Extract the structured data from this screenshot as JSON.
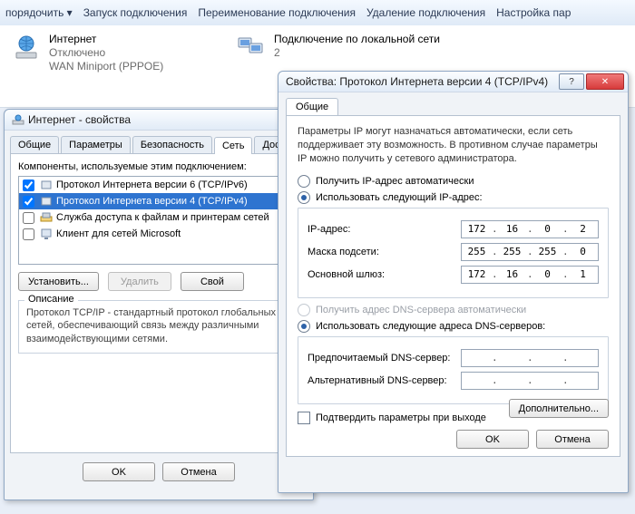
{
  "toolbar": {
    "items": [
      "порядочить ▾",
      "Запуск подключения",
      "Переименование подключения",
      "Удаление подключения",
      "Настройка пар"
    ]
  },
  "connections": {
    "a": {
      "title": "Интернет",
      "status": "Отключено",
      "sub": "WAN Miniport (PPPOE)"
    },
    "b": {
      "title": "Подключение по локальной сети",
      "status": "2",
      "sub": ""
    }
  },
  "props": {
    "title": "Интернет - свойства",
    "tabs": [
      "Общие",
      "Параметры",
      "Безопасность",
      "Сеть",
      "Досту"
    ],
    "active_tab": 3,
    "list_label": "Компоненты, используемые этим подключением:",
    "items": [
      {
        "checked": true,
        "label": "Протокол Интернета версии 6 (TCP/IPv6)"
      },
      {
        "checked": true,
        "label": "Протокол Интернета версии 4 (TCP/IPv4)"
      },
      {
        "checked": false,
        "label": "Служба доступа к файлам и принтерам сетей"
      },
      {
        "checked": false,
        "label": "Клиент для сетей Microsoft"
      }
    ],
    "selected_item": 1,
    "buttons": {
      "install": "Установить...",
      "remove": "Удалить",
      "props": "Свой"
    },
    "desc_title": "Описание",
    "desc_text": "Протокол TCP/IP - стандартный протокол глобальных сетей, обеспечивающий связь между различными взаимодействующими сетями.",
    "ok": "OK",
    "cancel": "Отмена"
  },
  "ip": {
    "title": "Свойства: Протокол Интернета версии 4 (TCP/IPv4)",
    "tab": "Общие",
    "intro": "Параметры IP могут назначаться автоматически, если сеть поддерживает эту возможность. В противном случае параметры IP можно получить у сетевого администратора.",
    "r_auto": "Получить IP-адрес автоматически",
    "r_manual": "Использовать следующий IP-адрес:",
    "f_ip": "IP-адрес:",
    "f_mask": "Маска подсети:",
    "f_gw": "Основной шлюз:",
    "v_ip": [
      "172",
      "16",
      "0",
      "2"
    ],
    "v_mask": [
      "255",
      "255",
      "255",
      "0"
    ],
    "v_gw": [
      "172",
      "16",
      "0",
      "1"
    ],
    "r_dns_auto": "Получить адрес DNS-сервера автоматически",
    "r_dns_manual": "Использовать следующие адреса DNS-серверов:",
    "f_dns1": "Предпочитаемый DNS-сервер:",
    "f_dns2": "Альтернативный DNS-сервер:",
    "v_dns1": [
      "",
      "",
      "",
      ""
    ],
    "v_dns2": [
      "",
      "",
      "",
      ""
    ],
    "confirm": "Подтвердить параметры при выходе",
    "advanced": "Дополнительно...",
    "ok": "OK",
    "cancel": "Отмена"
  }
}
